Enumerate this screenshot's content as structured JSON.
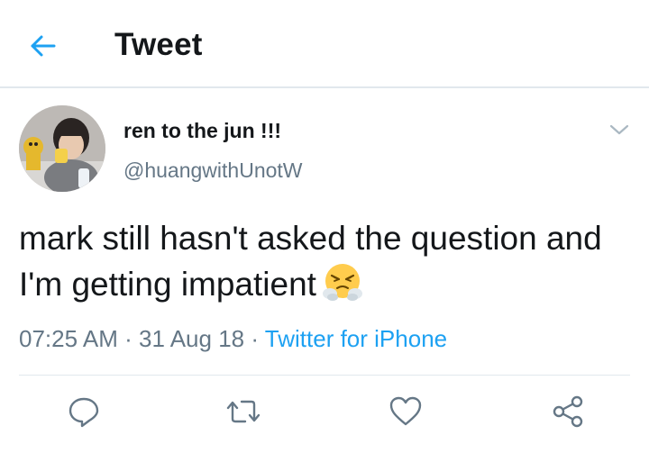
{
  "header": {
    "title": "Tweet",
    "back_icon": "arrow-left-icon"
  },
  "tweet": {
    "display_name": "ren to the jun !!!",
    "handle": "@huangwithUnotW",
    "text": "mark still hasn't asked the question and I'm getting impatient",
    "emoji": "face-with-steam-from-nose",
    "time": "07:25 AM",
    "separator": "·",
    "date": "31 Aug 18",
    "source": "Twitter for iPhone"
  },
  "actions": {
    "reply_icon": "reply-icon",
    "retweet_icon": "retweet-icon",
    "like_icon": "heart-icon",
    "share_icon": "share-icon"
  },
  "colors": {
    "accent": "#1da1f2",
    "secondary_text": "#657786",
    "primary_text": "#14171a",
    "divider": "#e1e8ed"
  }
}
